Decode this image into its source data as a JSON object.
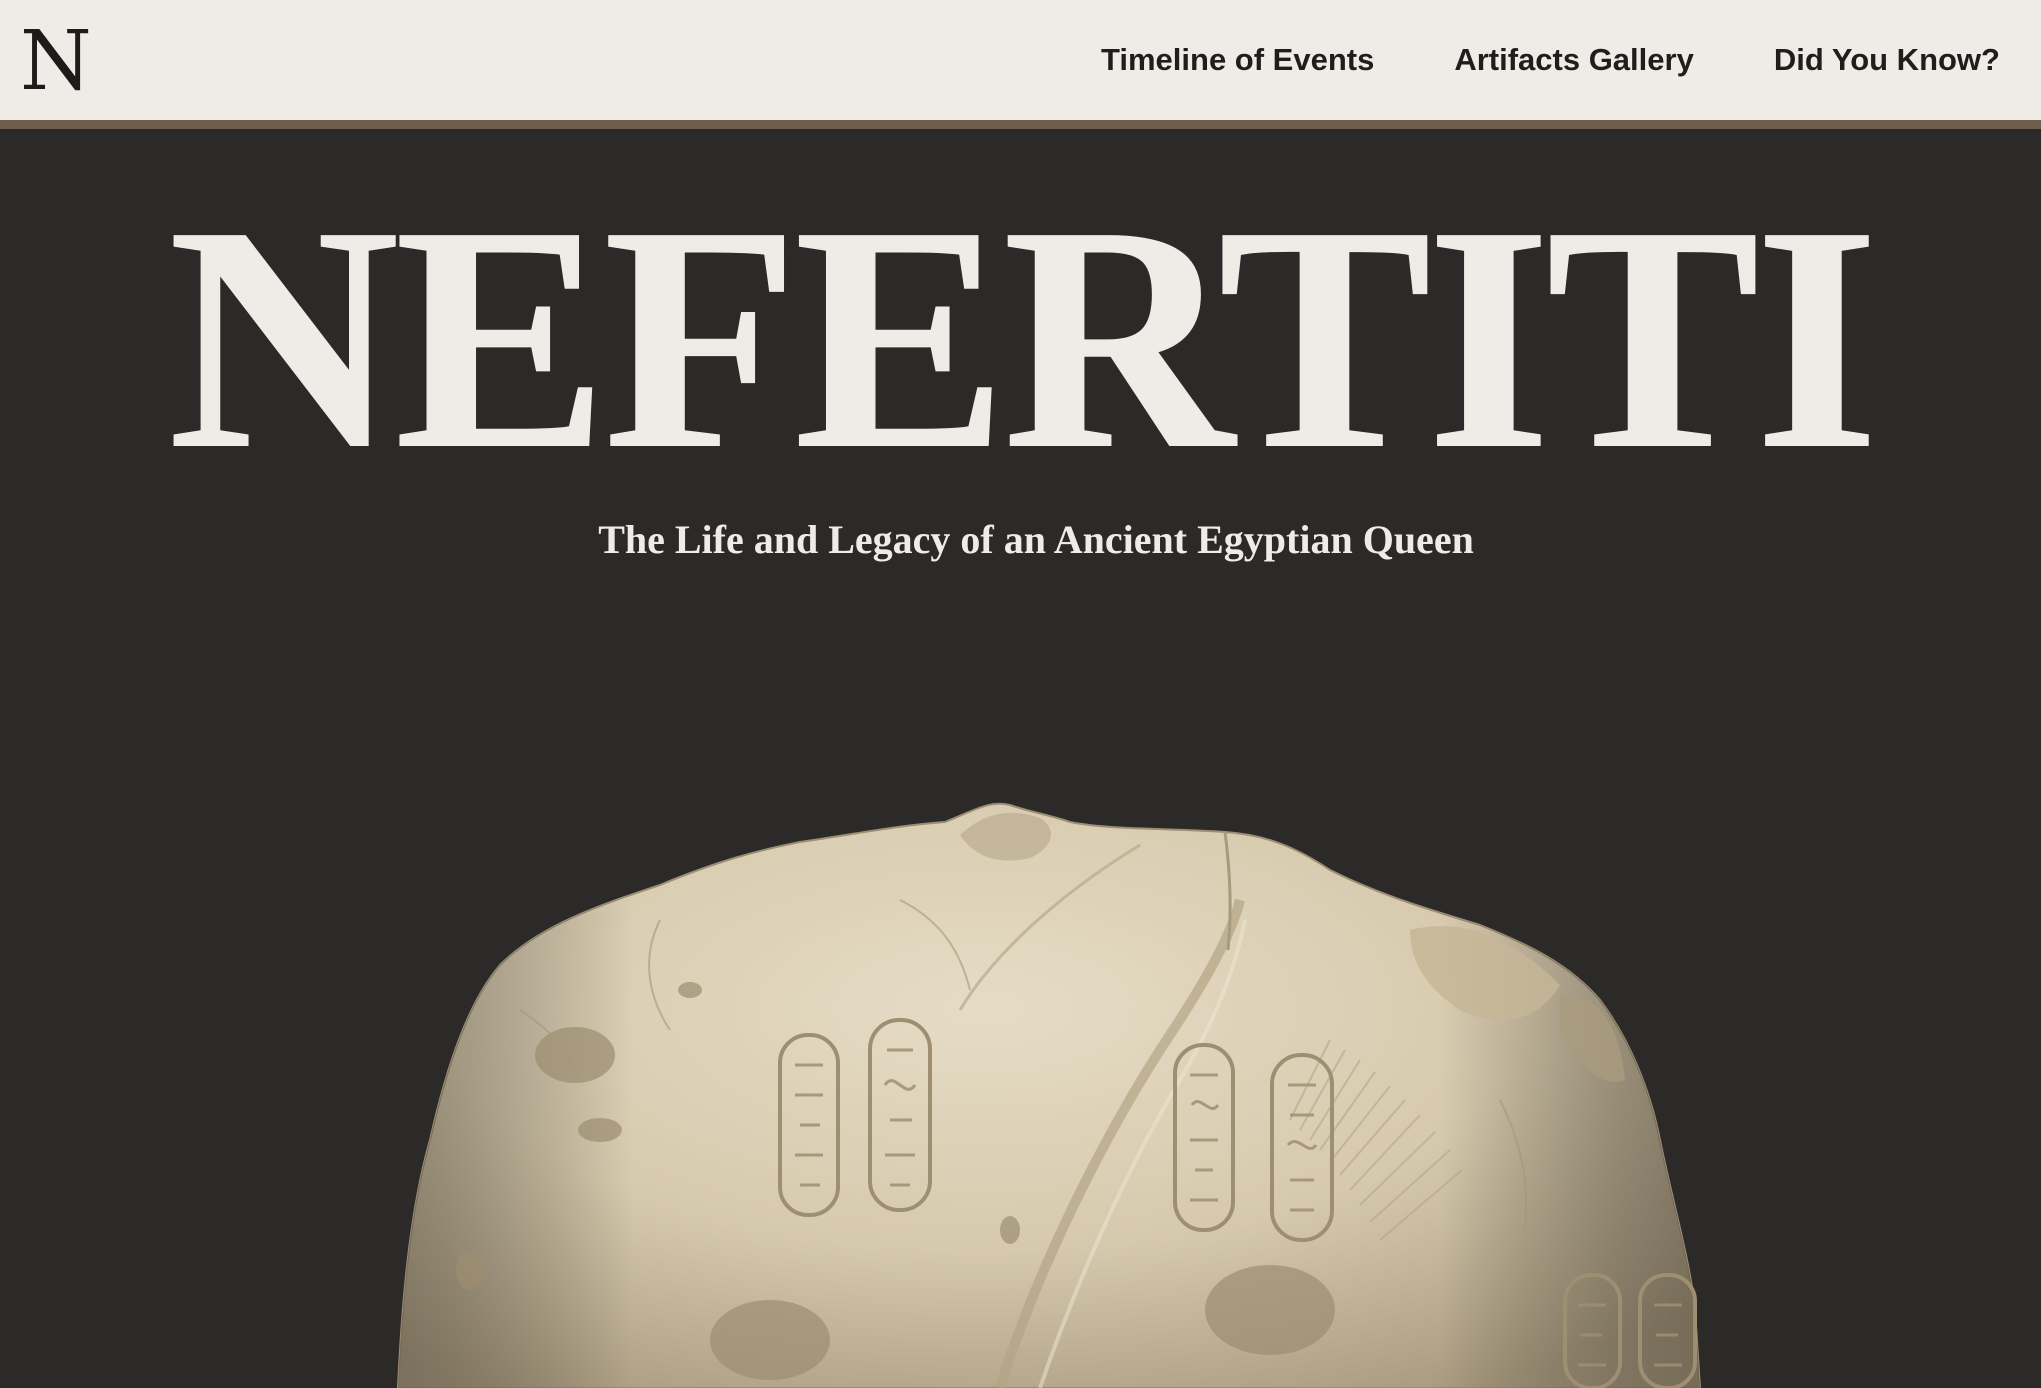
{
  "nav": {
    "logo": "N",
    "links": [
      {
        "label": "Timeline of Events"
      },
      {
        "label": "Artifacts Gallery"
      },
      {
        "label": "Did You Know?"
      }
    ]
  },
  "hero": {
    "title": "NEFERTITI",
    "subtitle": "The Life and Legacy of an Ancient Egyptian Queen",
    "image_alt": "statue-torso-image"
  },
  "colors": {
    "background": "#2b2a29",
    "nav_background": "#efebe6",
    "nav_border": "#6f5e4c",
    "text_light": "#efebe6",
    "text_dark": "#1f1e1d",
    "stone": "#d8ccb4"
  }
}
